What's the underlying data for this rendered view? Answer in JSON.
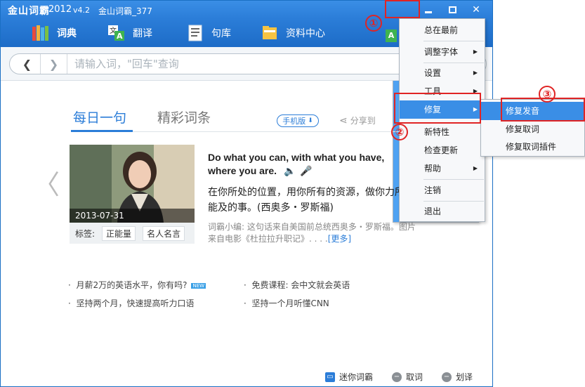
{
  "titlebar": {
    "logo": "金山词霸",
    "version_year": "2012",
    "version": "v4.2",
    "user": "金山词霸_377",
    "menu_glyph": "▼",
    "min_glyph": "▬",
    "max_glyph": "☐",
    "close_glyph": "✕"
  },
  "nav": {
    "items": [
      {
        "label": "词典",
        "icon": "books-icon"
      },
      {
        "label": "翻译",
        "icon": "translate-icon"
      },
      {
        "label": "句库",
        "icon": "sentence-library-icon"
      },
      {
        "label": "资料中心",
        "icon": "folder-icon"
      }
    ]
  },
  "search": {
    "back": "❮",
    "forward": "❯",
    "placeholder": "请输入词，\"回车\"查询"
  },
  "content": {
    "tabs": [
      {
        "label": "每日一句",
        "active": true
      },
      {
        "label": "精彩词条",
        "active": false
      }
    ],
    "mobile_button": "手机版",
    "share": "分享到",
    "left_arrow": "〈",
    "photo_date": "2013-07-31",
    "tags_label": "标签:",
    "tags": [
      "正能量",
      "名人名言"
    ],
    "quote_en": "Do what you can, with what you have, where you are.",
    "quote_cn": "在你所处的位置，用你所有的资源，做你力所能及的事。(西奥多・罗斯福)",
    "quote_note": "词霸小编: 这句话来自美国前总统西奥多・罗斯福。图片来自电影《杜拉拉升职记》. . . .",
    "more_link": "[更多]",
    "links": [
      {
        "label": "月薪2万的英语水平，你有吗?",
        "badge": "NEW"
      },
      {
        "label": "免费课程: 会中文就会英语"
      },
      {
        "label": "坚持两个月，快速提高听力口语"
      },
      {
        "label": "坚持一个月听懂CNN"
      }
    ]
  },
  "bottom": {
    "items": [
      {
        "label": "迷你词霸",
        "icon": "mini-dict-icon"
      },
      {
        "label": "取词",
        "icon": "pick-word-icon"
      },
      {
        "label": "划译",
        "icon": "select-translate-icon"
      }
    ]
  },
  "menu": {
    "items": [
      {
        "label": "总在最前",
        "has_submenu": false
      },
      {
        "label": "调整字体",
        "has_submenu": true
      },
      {
        "label": "设置",
        "has_submenu": true
      },
      {
        "label": "工具",
        "has_submenu": true
      },
      {
        "label": "修复",
        "has_submenu": true,
        "highlighted": true
      },
      {
        "label": "新特性",
        "has_submenu": false
      },
      {
        "label": "检查更新",
        "has_submenu": false
      },
      {
        "label": "帮助",
        "has_submenu": true
      },
      {
        "label": "注销",
        "has_submenu": false
      },
      {
        "label": "退出",
        "has_submenu": false
      }
    ],
    "submenu_arrow": "▶"
  },
  "submenu": {
    "items": [
      {
        "label": "修复发音",
        "highlighted": true
      },
      {
        "label": "修复取词"
      },
      {
        "label": "修复取词插件"
      }
    ]
  },
  "annotations": {
    "steps": [
      "①",
      "②",
      "③"
    ],
    "color": "#e02424"
  },
  "side_badge": "A"
}
